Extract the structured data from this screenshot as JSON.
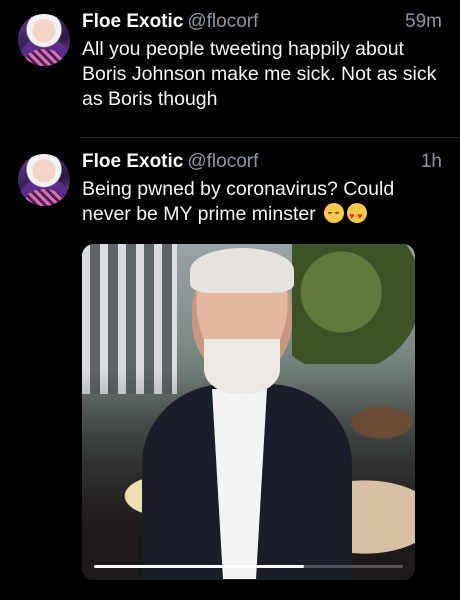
{
  "tweets": [
    {
      "name": "Floe Exotic",
      "handle": "@flocorf",
      "time": "59m",
      "text": "All you people tweeting happily about Boris Johnson make me sick. Not as sick as Boris though"
    },
    {
      "name": "Floe Exotic",
      "handle": "@flocorf",
      "time": "1h",
      "text": "Being pwned by coronavirus? Could never be MY prime minster",
      "emojis": [
        "relieved-face",
        "heart-eyes-face"
      ],
      "media": {
        "type": "video",
        "progress": 0.68
      }
    }
  ]
}
